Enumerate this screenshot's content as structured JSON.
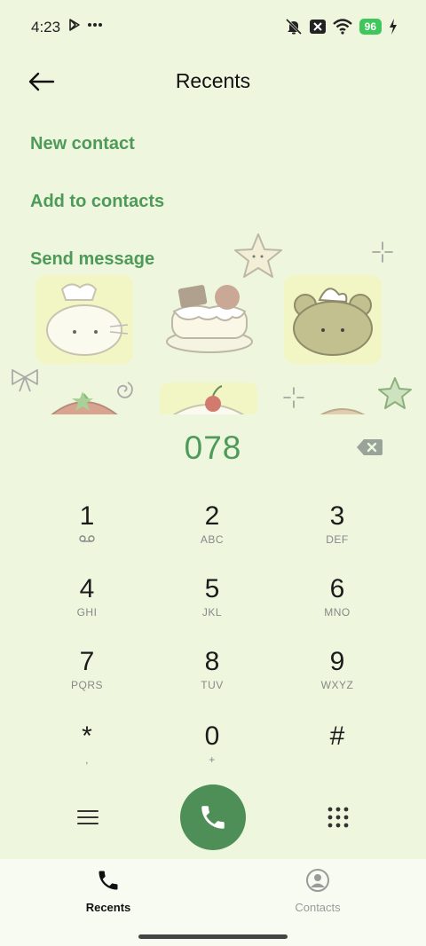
{
  "status_bar": {
    "time": "4:23",
    "battery": "96"
  },
  "header": {
    "title": "Recents"
  },
  "actions": {
    "new_contact": "New contact",
    "add_to_contacts": "Add to contacts",
    "send_message": "Send message"
  },
  "dialer": {
    "number": "078"
  },
  "keypad": [
    {
      "digit": "1",
      "letters": ""
    },
    {
      "digit": "2",
      "letters": "ABC"
    },
    {
      "digit": "3",
      "letters": "DEF"
    },
    {
      "digit": "4",
      "letters": "GHI"
    },
    {
      "digit": "5",
      "letters": "JKL"
    },
    {
      "digit": "6",
      "letters": "MNO"
    },
    {
      "digit": "7",
      "letters": "PQRS"
    },
    {
      "digit": "8",
      "letters": "TUV"
    },
    {
      "digit": "9",
      "letters": "WXYZ"
    },
    {
      "digit": "*",
      "letters": ","
    },
    {
      "digit": "0",
      "letters": "+"
    },
    {
      "digit": "#",
      "letters": ""
    }
  ],
  "bottom_nav": {
    "recents": "Recents",
    "contacts": "Contacts"
  },
  "colors": {
    "background": "#EEF6DE",
    "accent_green": "#4D9A59",
    "call_button": "#4E8F57",
    "battery": "#3FC75B"
  }
}
